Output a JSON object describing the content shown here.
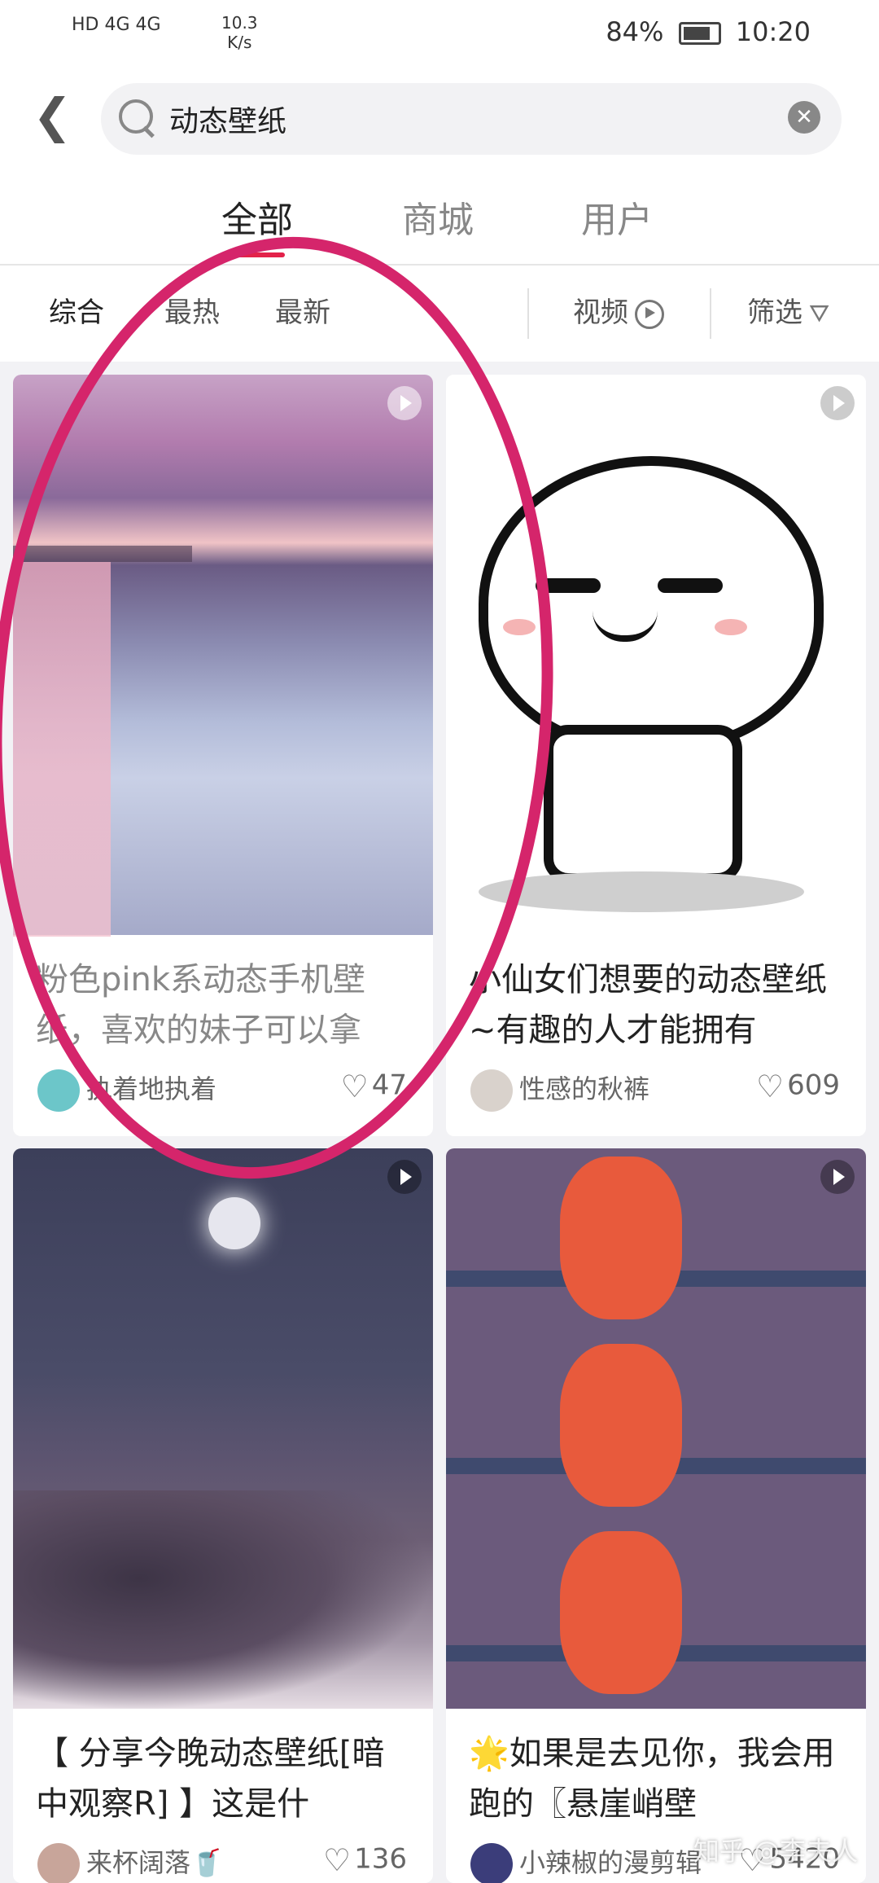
{
  "status_bar": {
    "left_text": "HD 4G 4G",
    "net_speed": "10.3",
    "net_unit": "K/s",
    "battery": "84%",
    "time": "10:20"
  },
  "search": {
    "query": "动态壁纸"
  },
  "tabs": [
    "全部",
    "商城",
    "用户"
  ],
  "filters": {
    "sort": [
      "综合",
      "最热",
      "最新"
    ],
    "video": "视频",
    "filter": "筛选"
  },
  "cards": [
    {
      "title": "粉色pink系动态手机壁纸，喜欢的妹子可以拿",
      "author": "执着地执着",
      "likes": "47"
    },
    {
      "title": "小仙女们想要的动态壁纸~有趣的人才能拥有",
      "author": "性感的秋裤",
      "likes": "609"
    },
    {
      "title": "【 分享今晚动态壁纸[暗中观察R] 】这是什",
      "author": "来杯阔落🥤",
      "likes": "136"
    },
    {
      "title": "🌟如果是去见你，我会用跑的〖悬崖峭壁",
      "author": "小辣椒的漫剪辑",
      "likes": "5420"
    }
  ],
  "watermark": "知乎 @李夫人",
  "colors": {
    "accent": "#e3224a",
    "annotation": "#d5256b"
  }
}
